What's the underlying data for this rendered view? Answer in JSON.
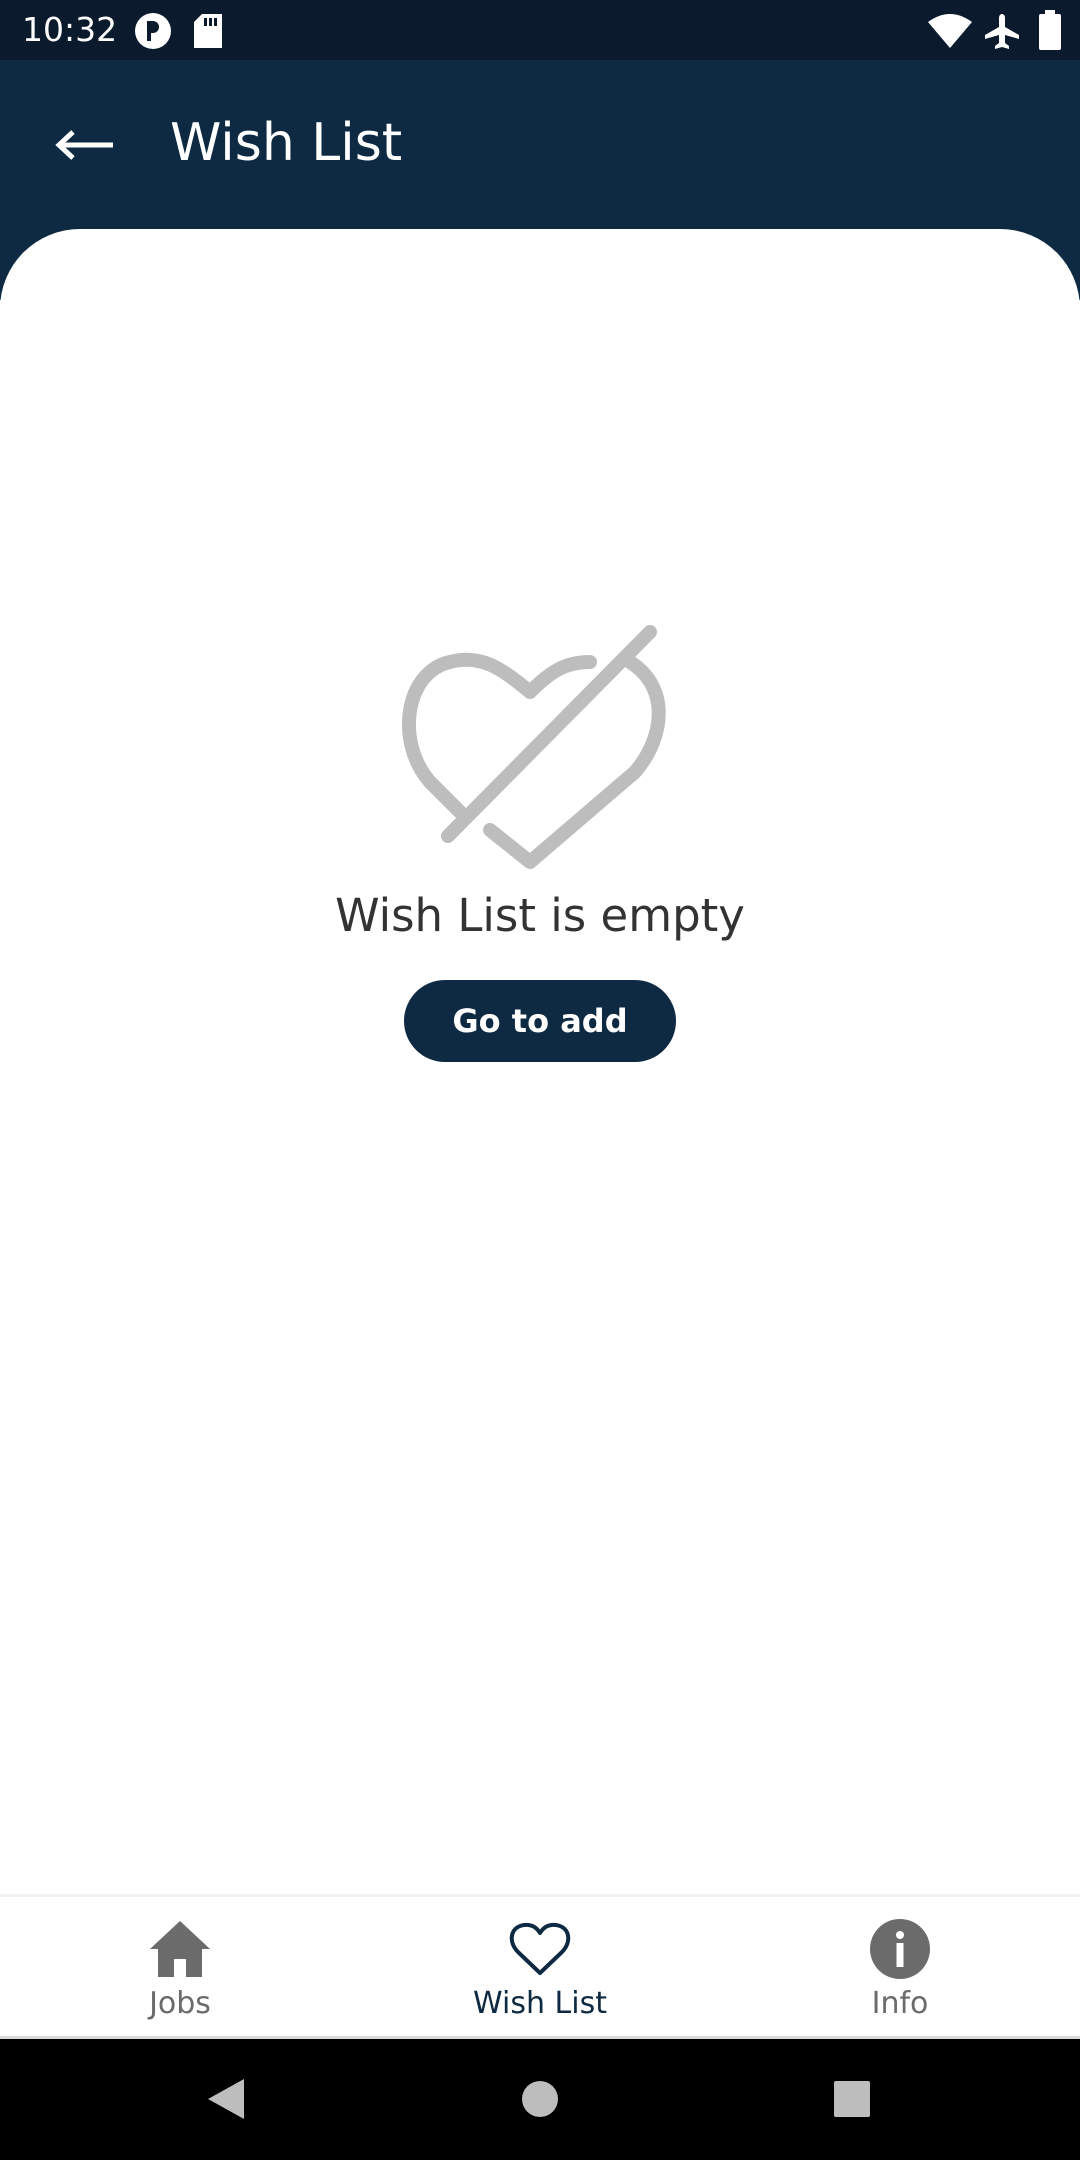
{
  "status_bar": {
    "time": "10:32",
    "left_icons": [
      "p-app-icon",
      "sd-card-icon"
    ],
    "right_icons": [
      "wifi-icon",
      "airplane-icon",
      "battery-icon"
    ]
  },
  "app_bar": {
    "title": "Wish List",
    "back_icon": "arrow-left-icon"
  },
  "empty_state": {
    "icon": "heart-off-icon",
    "message": "Wish List is empty",
    "button_label": "Go to add"
  },
  "bottom_nav": {
    "items": [
      {
        "label": "Jobs",
        "icon": "home-icon",
        "active": false
      },
      {
        "label": "Wish List",
        "icon": "heart-outline-icon",
        "active": true
      },
      {
        "label": "Info",
        "icon": "info-icon",
        "active": false
      }
    ]
  },
  "system_nav": {
    "buttons": [
      "back-triangle-icon",
      "home-circle-icon",
      "recents-square-icon"
    ]
  },
  "colors": {
    "status_bar_bg": "#0b1b2d",
    "app_bar_bg": "#0e2a42",
    "icon_gray": "#bdbdbd",
    "nav_inactive": "#6b6b6b",
    "nav_active": "#0e2a42"
  }
}
